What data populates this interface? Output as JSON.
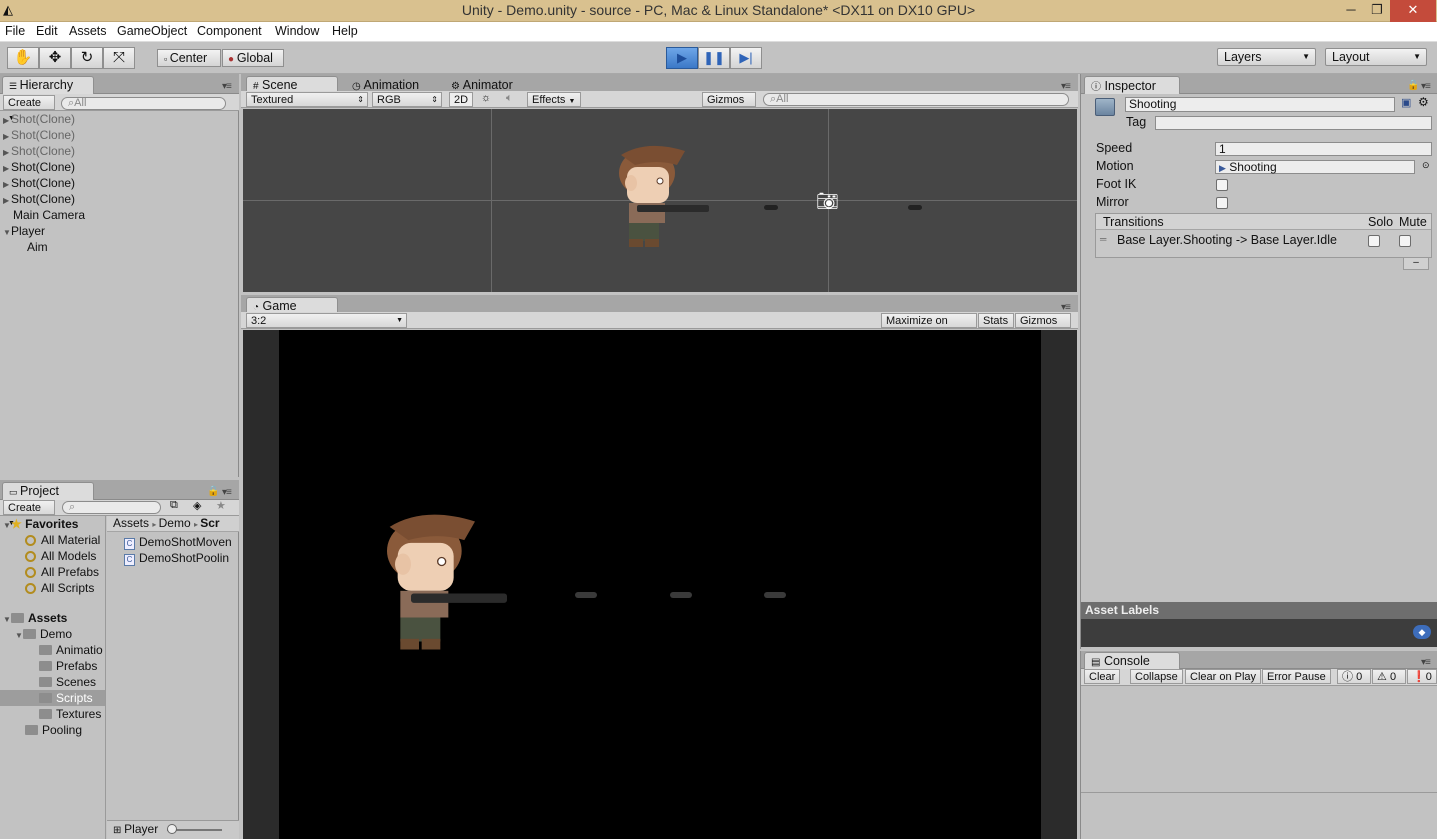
{
  "window": {
    "title": "Unity - Demo.unity - source - PC, Mac & Linux Standalone* <DX11 on DX10 GPU>"
  },
  "menu": [
    "File",
    "Edit",
    "Assets",
    "GameObject",
    "Component",
    "Window",
    "Help"
  ],
  "toolbar": {
    "pivot": "Center",
    "space": "Global",
    "layers": "Layers",
    "layout": "Layout"
  },
  "hierarchy": {
    "tab": "Hierarchy",
    "create": "Create",
    "search_placeholder": "All",
    "items": [
      {
        "label": "Shot(Clone)"
      },
      {
        "label": "Shot(Clone)"
      },
      {
        "label": "Shot(Clone)"
      },
      {
        "label": "Shot(Clone)"
      },
      {
        "label": "Shot(Clone)"
      },
      {
        "label": "Shot(Clone)"
      },
      {
        "label": "Main Camera"
      },
      {
        "label": "Player"
      },
      {
        "label": "Aim"
      }
    ]
  },
  "scene": {
    "tabs": [
      "Scene",
      "Animation",
      "Animator"
    ],
    "shading": "Textured",
    "color": "RGB",
    "mode2d": "2D",
    "effects": "Effects",
    "gizmos": "Gizmos",
    "search_placeholder": "All"
  },
  "game": {
    "tab": "Game",
    "aspect": "3:2",
    "maximize": "Maximize on Play",
    "stats": "Stats",
    "gizmos": "Gizmos"
  },
  "project": {
    "tab": "Project",
    "create": "Create",
    "favorites_label": "Favorites",
    "favorites": [
      "All Material",
      "All Models",
      "All Prefabs",
      "All Scripts"
    ],
    "assets_label": "Assets",
    "tree": [
      "Demo",
      "Animatio",
      "Prefabs",
      "Scenes",
      "Scripts",
      "Textures",
      "Pooling"
    ],
    "breadcrumb": [
      "Assets",
      "Demo",
      "Scr"
    ],
    "files": [
      "DemoShotMoven",
      "DemoShotPoolin"
    ],
    "footer": "Player"
  },
  "inspector": {
    "tab": "Inspector",
    "name": "Shooting",
    "tag_label": "Tag",
    "speed_label": "Speed",
    "speed_value": "1",
    "motion_label": "Motion",
    "motion_value": "Shooting",
    "footik_label": "Foot IK",
    "mirror_label": "Mirror",
    "transitions_label": "Transitions",
    "solo": "Solo",
    "mute": "Mute",
    "transition": "Base Layer.Shooting -> Base Layer.Idle",
    "minus": "–",
    "asset_labels": "Asset Labels"
  },
  "console": {
    "tab": "Console",
    "clear": "Clear",
    "collapse": "Collapse",
    "clear_on_play": "Clear on Play",
    "error_pause": "Error Pause",
    "count_info": "0",
    "count_warn": "0",
    "count_err": "0"
  },
  "colors": {
    "play_active": "#4a8ad8",
    "viewport_bg": "#000000",
    "scene_bg": "#464646"
  }
}
